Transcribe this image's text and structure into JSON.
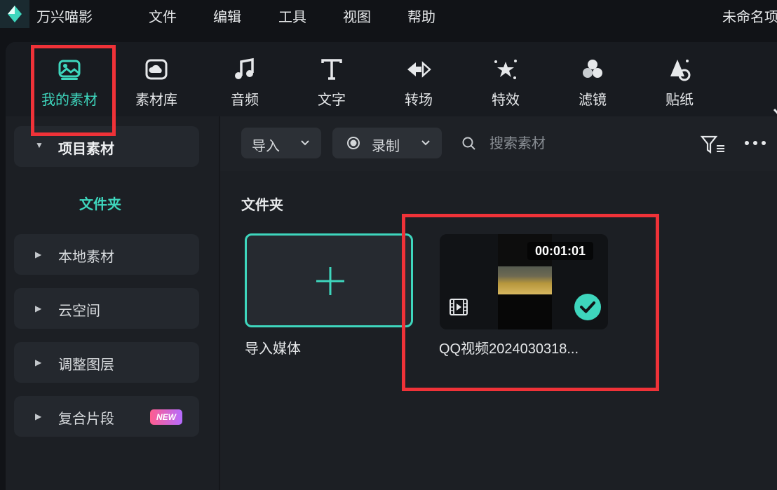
{
  "app": {
    "name": "万兴喵影",
    "project_title": "未命名项目"
  },
  "menu": [
    "文件",
    "编辑",
    "工具",
    "视图",
    "帮助"
  ],
  "toolbar": {
    "tabs": [
      {
        "label": "我的素材",
        "icon": "media-icon",
        "active": true
      },
      {
        "label": "素材库",
        "icon": "stock-cloud-icon"
      },
      {
        "label": "音频",
        "icon": "music-note-icon"
      },
      {
        "label": "文字",
        "icon": "text-t-icon"
      },
      {
        "label": "转场",
        "icon": "transition-icon"
      },
      {
        "label": "特效",
        "icon": "effects-star-icon"
      },
      {
        "label": "滤镜",
        "icon": "filter-circles-icon"
      },
      {
        "label": "贴纸",
        "icon": "sticker-icon"
      }
    ]
  },
  "sidebar": {
    "project_media": "项目素材",
    "folder": "文件夹",
    "items": [
      "本地素材",
      "云空间",
      "调整图层",
      "复合片段"
    ],
    "new_badge": "NEW"
  },
  "content_toolbar": {
    "import_label": "导入",
    "record_label": "录制",
    "search_placeholder": "搜索素材"
  },
  "main": {
    "section_title": "文件夹",
    "import_tile_label": "导入媒体",
    "media_items": [
      {
        "name": "QQ视频2024030318...",
        "duration": "00:01:01",
        "selected": true
      }
    ]
  },
  "colors": {
    "accent": "#3ed6bd",
    "highlight": "#ef3238",
    "background": "#111317",
    "panel": "#1c1f24"
  }
}
